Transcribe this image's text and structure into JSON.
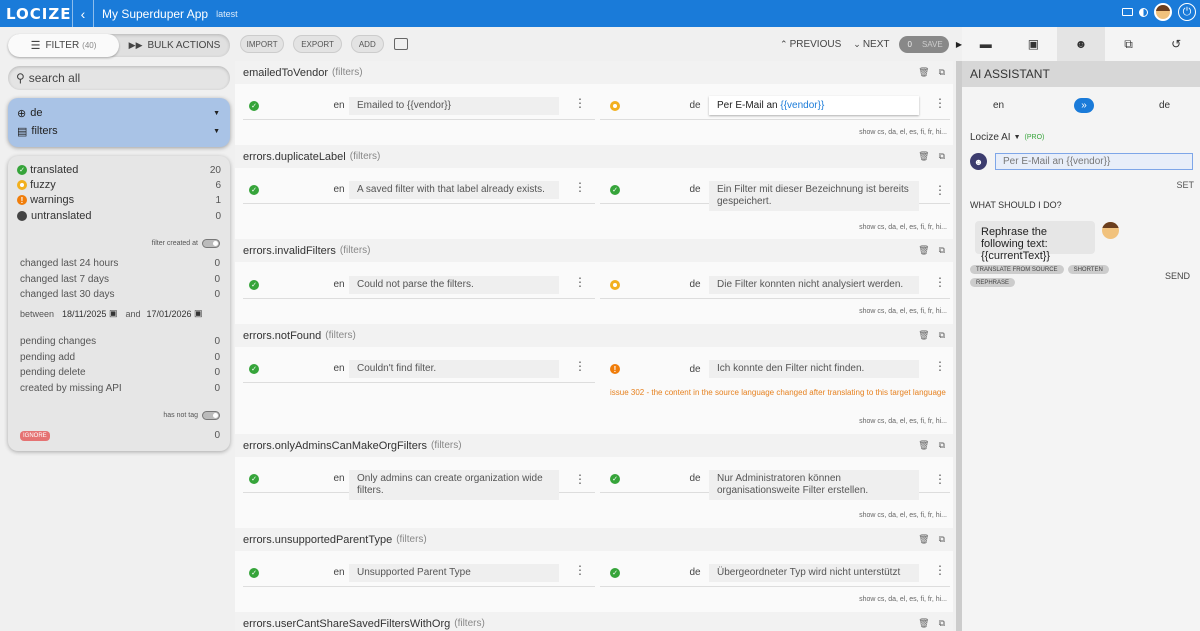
{
  "app": {
    "logo": "LOCIZE",
    "title": "My Superduper App",
    "version": "latest"
  },
  "left": {
    "filter_label": "FILTER",
    "filter_count": "(40)",
    "bulk_label": "BULK ACTIONS",
    "search_placeholder": "search all",
    "language": "de",
    "namespace": "filters",
    "stats": [
      {
        "label": "translated",
        "count": "20"
      },
      {
        "label": "fuzzy",
        "count": "6"
      },
      {
        "label": "warnings",
        "count": "1"
      },
      {
        "label": "untranslated",
        "count": "0"
      }
    ],
    "filter_created_at": "filter created at",
    "changed": [
      {
        "label": "changed last 24 hours",
        "count": "0"
      },
      {
        "label": "changed last 7 days",
        "count": "0"
      },
      {
        "label": "changed last 30 days",
        "count": "0"
      }
    ],
    "between": "between",
    "date_from": "18/11/2025",
    "and": "and",
    "date_to": "17/01/2026",
    "pending": [
      {
        "label": "pending changes",
        "count": "0"
      },
      {
        "label": "pending add",
        "count": "0"
      },
      {
        "label": "pending delete",
        "count": "0"
      },
      {
        "label": "created by missing API",
        "count": "0"
      }
    ],
    "has_not_tag": "has not tag",
    "ignore": "IGNORE",
    "ignore_count": "0"
  },
  "toolbar": {
    "import": "IMPORT",
    "export": "EXPORT",
    "add": "ADD",
    "previous": "PREVIOUS",
    "next": "NEXT",
    "save_count": "0",
    "save": "SAVE"
  },
  "keys": [
    {
      "name": "emailedToVendor",
      "ns": "(filters)",
      "src": "Emailed to {{vendor}}",
      "tgt_pre": "Per E-Mail an ",
      "tgt_var": "{{vendor}}",
      "status": "fuzzy",
      "show": "show cs, da, el, es, fi, fr, hi..."
    },
    {
      "name": "errors.duplicateLabel",
      "ns": "(filters)",
      "src": "A saved filter with that label already exists.",
      "tgt": "Ein Filter mit dieser Bezeichnung ist bereits gespeichert.",
      "status": "ok",
      "show": "show cs, da, el, es, fi, fr, hi..."
    },
    {
      "name": "errors.invalidFilters",
      "ns": "(filters)",
      "src": "Could not parse the filters.",
      "tgt": "Die Filter konnten nicht analysiert werden.",
      "status": "fuzzy",
      "show": "show cs, da, el, es, fi, fr, hi..."
    },
    {
      "name": "errors.notFound",
      "ns": "(filters)",
      "src": "Couldn't find filter.",
      "tgt": "Ich konnte den Filter nicht finden.",
      "status": "warning",
      "issue": "issue 302 - the content in the source language changed after translating to this target language",
      "show": "show cs, da, el, es, fi, fr, hi..."
    },
    {
      "name": "errors.onlyAdminsCanMakeOrgFilters",
      "ns": "(filters)",
      "src": "Only admins can create organization wide filters.",
      "tgt": "Nur Administratoren können organisationsweite Filter erstellen.",
      "status": "ok",
      "show": "show cs, da, el, es, fi, fr, hi..."
    },
    {
      "name": "errors.unsupportedParentType",
      "ns": "(filters)",
      "src": "Unsupported Parent Type",
      "tgt": "Übergeordneter Typ wird nicht unterstützt",
      "status": "ok",
      "show": "show cs, da, el, es, fi, fr, hi..."
    },
    {
      "name": "errors.userCantShareSavedFiltersWithOrg",
      "ns": "(filters)"
    }
  ],
  "src_lang": "en",
  "tgt_lang": "de",
  "ai": {
    "header": "AI ASSISTANT",
    "from": "en",
    "to": "de",
    "model": "Locize AI",
    "pro": "(PRO)",
    "result": "Per E-Mail an {{vendor}}",
    "set": "SET",
    "what": "WHAT SHOULD I DO?",
    "prompt": "Rephrase the following text: {{currentText}}",
    "chips": [
      "TRANSLATE FROM SOURCE",
      "SHORTEN",
      "REPHRASE"
    ],
    "send": "SEND"
  },
  "colors": {
    "brand": "#1a7bd9",
    "ok": "#36a43a",
    "fuzzy": "#f2b01e",
    "warning": "#f07d0a"
  }
}
